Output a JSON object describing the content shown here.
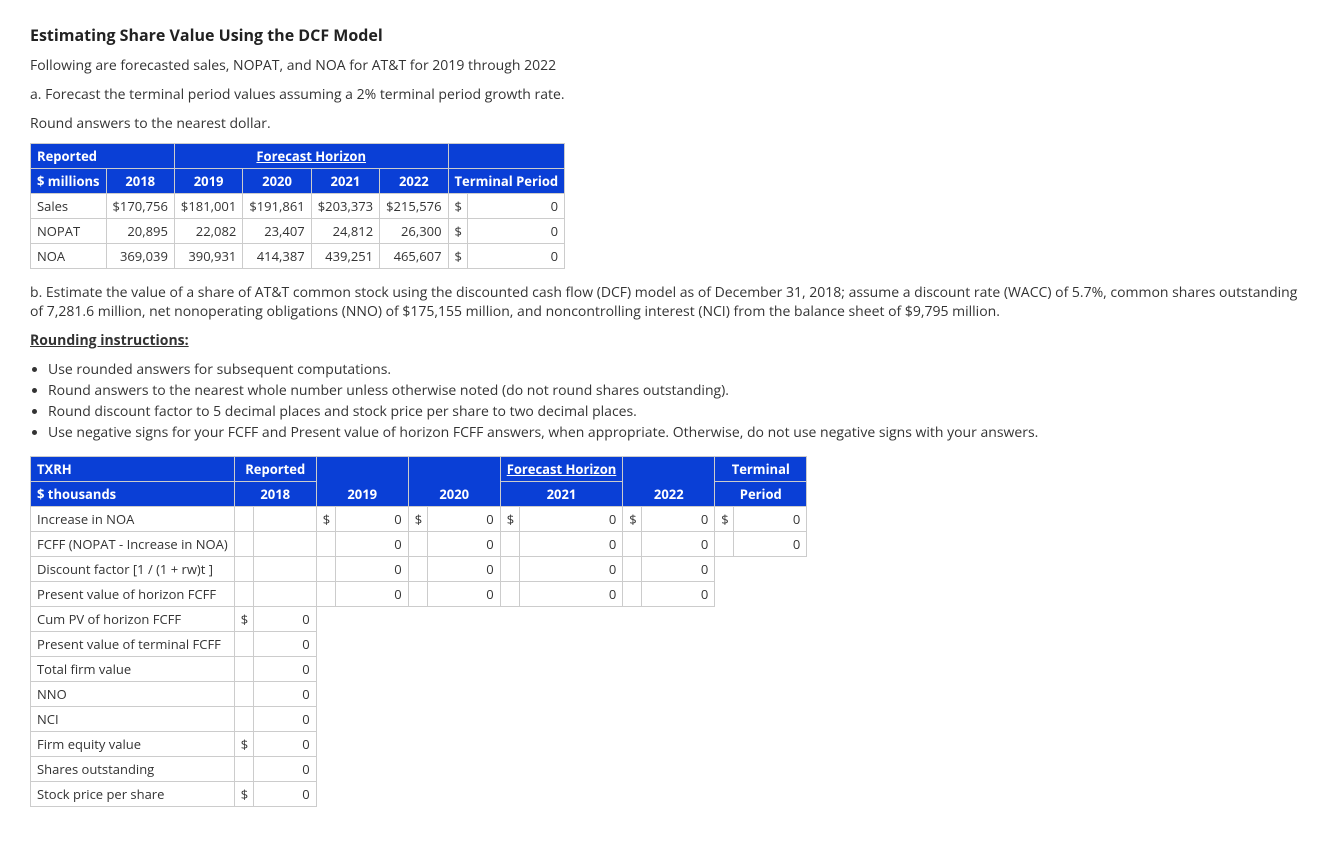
{
  "heading": "Estimating Share Value Using the DCF Model",
  "intro": "Following are forecasted sales, NOPAT, and NOA for AT&T for 2019 through 2022",
  "qa": "a. Forecast the terminal period values assuming a 2% terminal period growth rate.",
  "round_note": "Round answers to the nearest dollar.",
  "t1": {
    "hdr_reported": "Reported",
    "hdr_forecast": "Forecast Horizon",
    "col_unit": "$ millions",
    "cols": [
      "2018",
      "2019",
      "2020",
      "2021",
      "2022",
      "Terminal Period"
    ],
    "rows": [
      {
        "label": "Sales",
        "v": [
          "$170,756",
          "$181,001",
          "$191,861",
          "$203,373",
          "$215,576"
        ],
        "ds": "$",
        "inp": "0"
      },
      {
        "label": "NOPAT",
        "v": [
          "20,895",
          "22,082",
          "23,407",
          "24,812",
          "26,300"
        ],
        "ds": "$",
        "inp": "0"
      },
      {
        "label": "NOA",
        "v": [
          "369,039",
          "390,931",
          "414,387",
          "439,251",
          "465,607"
        ],
        "ds": "$",
        "inp": "0"
      }
    ]
  },
  "qb": "b. Estimate the value of a share of AT&T common stock using the discounted cash flow (DCF) model as of December 31, 2018; assume a discount rate (WACC) of 5.7%, common shares outstanding of 7,281.6 million, net nonoperating obligations (NNO) of $175,155 million, and noncontrolling interest (NCI) from the balance sheet of $9,795 million.",
  "ri_title": "Rounding instructions:",
  "ri": [
    "Use rounded answers for subsequent computations.",
    "Round answers to the nearest whole number unless otherwise noted (do not round shares outstanding).",
    "Round discount factor to 5 decimal places and stock price per share to two decimal places.",
    "Use negative signs for your FCFF and Present value of horizon FCFF answers, when appropriate. Otherwise, do not use negative signs with your answers."
  ],
  "t2": {
    "hdr_txrh": "TXRH",
    "hdr_unit": "$ thousands",
    "hdr_reported": "Reported",
    "hdr_2018": "2018",
    "hdr_forecast": "Forecast Horizon",
    "hdr_terminal": "Terminal",
    "hdr_period": "Period",
    "cols_years": [
      "2019",
      "2020",
      "2021",
      "2022"
    ],
    "rows_main": [
      {
        "label": "Increase in NOA",
        "ds": "$",
        "vals": [
          "0",
          "0",
          "0",
          "0",
          "0"
        ]
      },
      {
        "label": "FCFF (NOPAT - Increase in NOA)",
        "ds": "",
        "vals": [
          "0",
          "0",
          "0",
          "0",
          "0"
        ]
      },
      {
        "label": "Discount factor [1 / (1 + rw)t ]",
        "ds": "",
        "vals": [
          "0",
          "0",
          "0",
          "0",
          null
        ]
      },
      {
        "label": "Present value of horizon FCFF",
        "ds": "",
        "vals": [
          "0",
          "0",
          "0",
          "0",
          null
        ]
      }
    ],
    "rows_single": [
      {
        "label": "Cum PV of horizon FCFF",
        "ds": "$",
        "val": "0"
      },
      {
        "label": "Present value of terminal FCFF",
        "ds": "",
        "val": "0"
      },
      {
        "label": "Total firm value",
        "ds": "",
        "val": "0"
      },
      {
        "label": "NNO",
        "ds": "",
        "val": "0"
      },
      {
        "label": "NCI",
        "ds": "",
        "val": "0"
      },
      {
        "label": "Firm equity value",
        "ds": "$",
        "val": "0"
      },
      {
        "label": "Shares outstanding",
        "ds": "",
        "val": "0"
      },
      {
        "label": "Stock price per share",
        "ds": "$",
        "val": "0"
      }
    ]
  }
}
